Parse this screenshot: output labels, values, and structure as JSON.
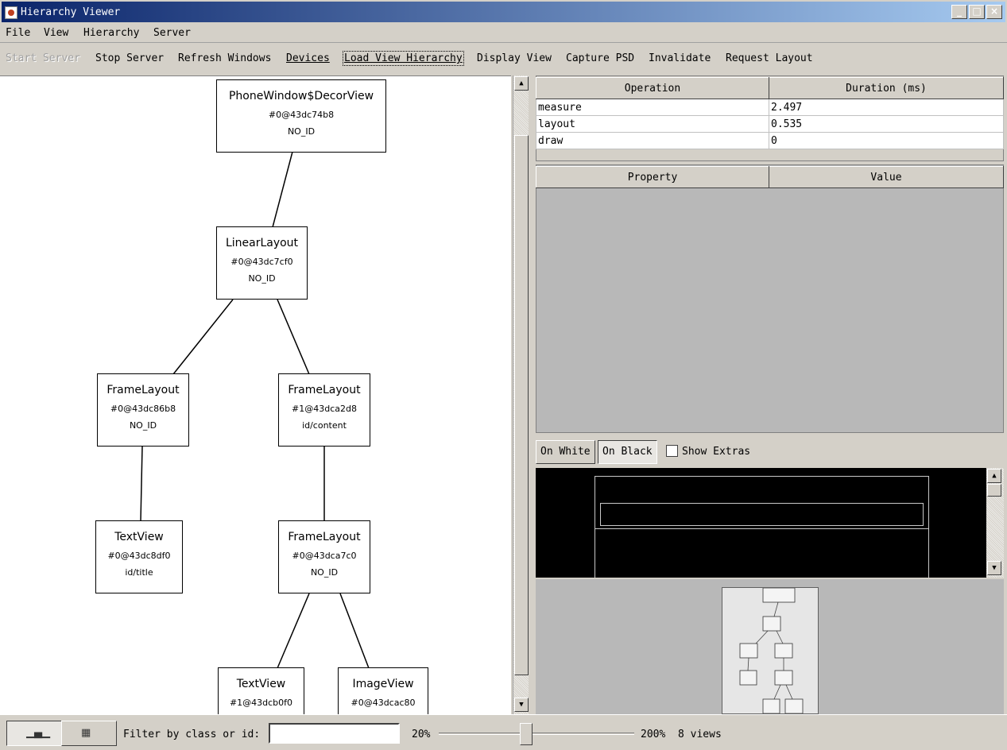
{
  "window": {
    "title": "Hierarchy Viewer",
    "controls": [
      "_",
      "□",
      "×"
    ]
  },
  "menu": [
    "File",
    "View",
    "Hierarchy",
    "Server"
  ],
  "toolbar": {
    "start_server": "Start Server",
    "stop_server": "Stop Server",
    "refresh_windows": "Refresh Windows",
    "devices": "Devices",
    "load_view_hierarchy": "Load View Hierarchy",
    "display_view": "Display View",
    "capture_psd": "Capture PSD",
    "invalidate": "Invalidate",
    "request_layout": "Request Layout"
  },
  "tree": {
    "nodes": [
      {
        "class": "PhoneWindow$DecorView",
        "hash": "#0@43dc74b8",
        "id": "NO_ID"
      },
      {
        "class": "LinearLayout",
        "hash": "#0@43dc7cf0",
        "id": "NO_ID"
      },
      {
        "class": "FrameLayout",
        "hash": "#0@43dc86b8",
        "id": "NO_ID"
      },
      {
        "class": "FrameLayout",
        "hash": "#1@43dca2d8",
        "id": "id/content"
      },
      {
        "class": "TextView",
        "hash": "#0@43dc8df0",
        "id": "id/title"
      },
      {
        "class": "FrameLayout",
        "hash": "#0@43dca7c0",
        "id": "NO_ID"
      },
      {
        "class": "TextView",
        "hash": "#1@43dcb0f0",
        "id": ""
      },
      {
        "class": "ImageView",
        "hash": "#0@43dcac80",
        "id": ""
      }
    ]
  },
  "timing": {
    "headers": [
      "Operation",
      "Duration (ms)"
    ],
    "rows": [
      {
        "op": "measure",
        "dur": "2.497"
      },
      {
        "op": "layout",
        "dur": "0.535"
      },
      {
        "op": "draw",
        "dur": "0"
      }
    ]
  },
  "properties": {
    "headers": [
      "Property",
      "Value"
    ]
  },
  "preview_controls": {
    "on_white": "On White",
    "on_black": "On Black",
    "show_extras": "Show Extras",
    "show_extras_checked": false
  },
  "status": {
    "filter_label": "Filter by class or id:",
    "filter_value": "",
    "zoom_min": "20%",
    "zoom_max": "200%",
    "zoom_level": 0.44,
    "view_count": "8 views"
  },
  "icons": {
    "tree_view": "tree-layout-icon",
    "grid_view": "grid-layout-icon",
    "app": "java-cup-icon"
  }
}
